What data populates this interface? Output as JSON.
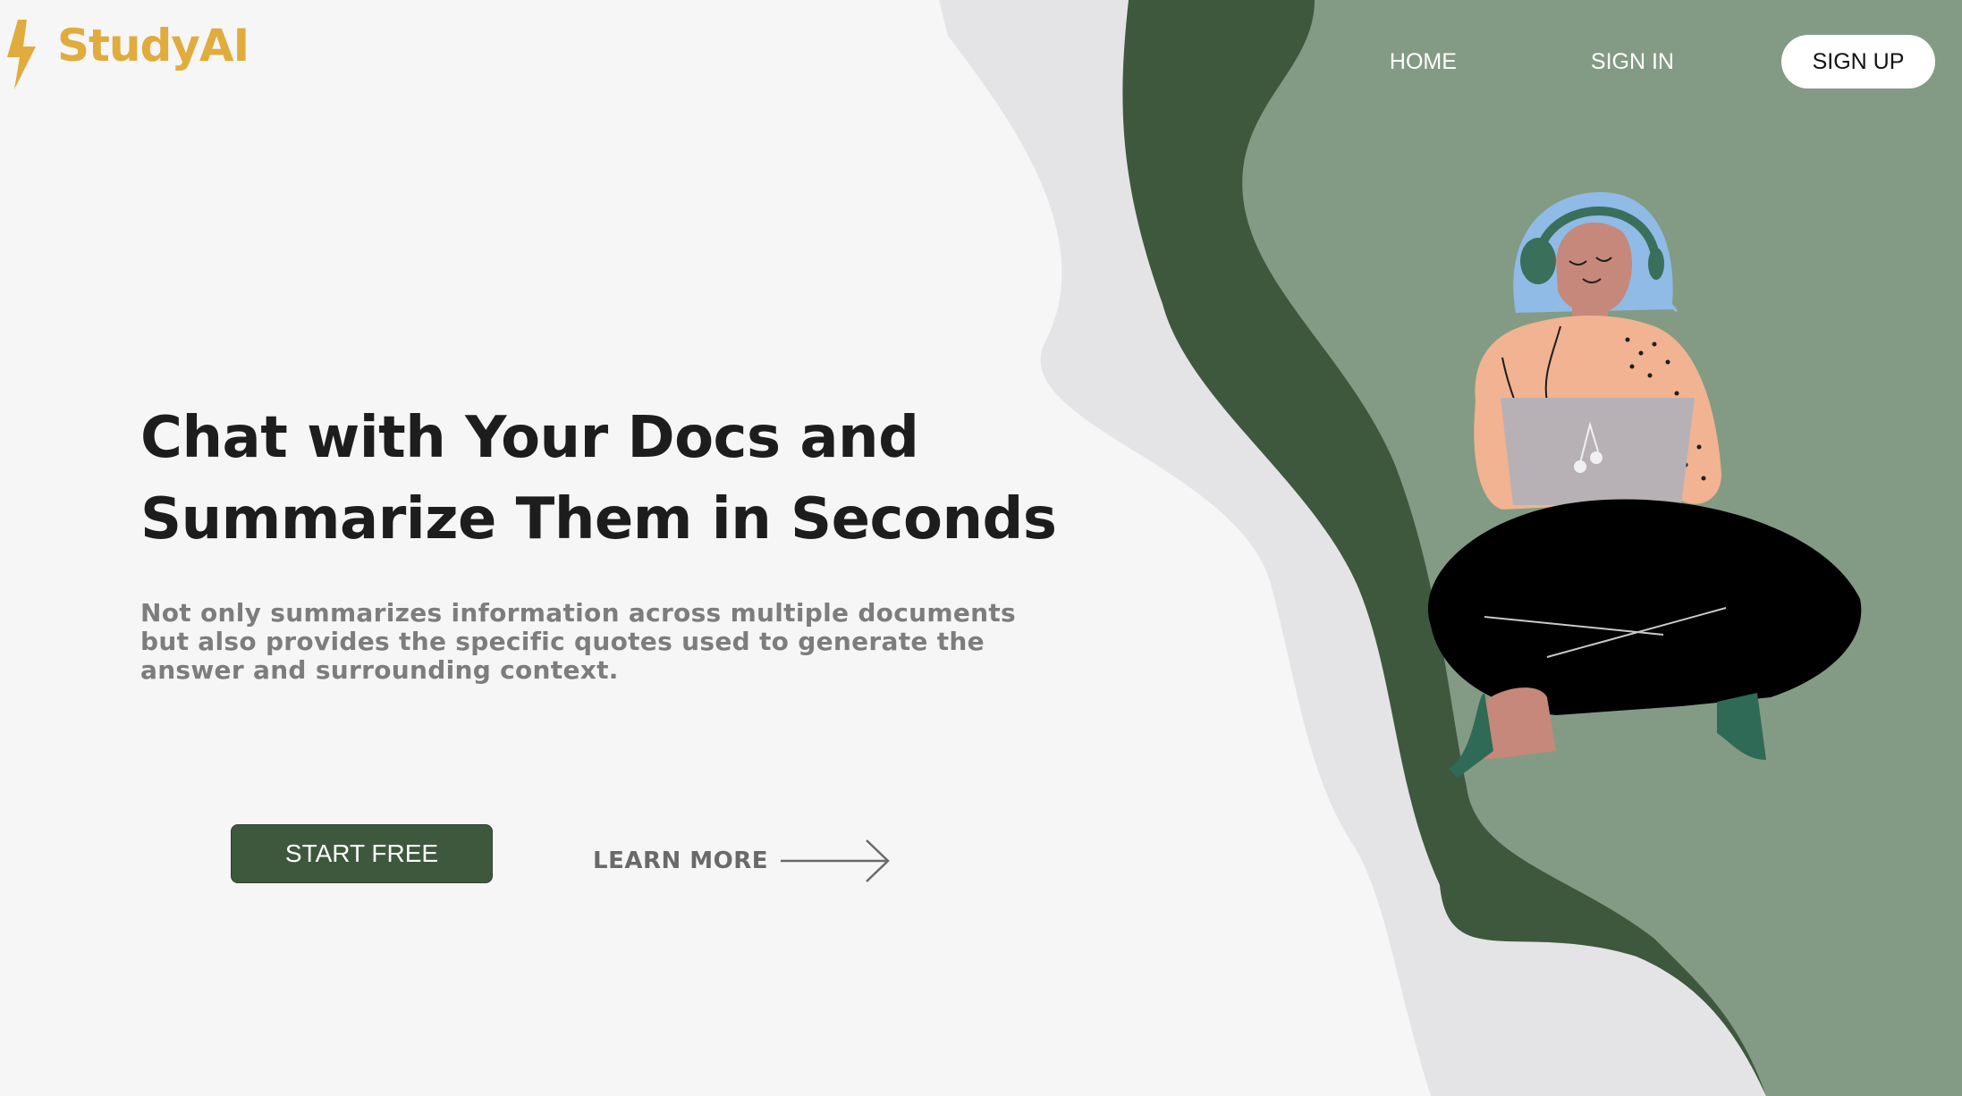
{
  "brand": {
    "name": "StudyAI",
    "logo_icon": "lightning-bolt-icon",
    "color": "#e0ac3e"
  },
  "nav": {
    "home": "HOME",
    "sign_in": "SIGN IN",
    "sign_up": "SIGN UP"
  },
  "hero": {
    "title_line1": "Chat with Your Docs and",
    "title_line2": "Summarize Them in Seconds",
    "description": "Not only summarizes information across multiple documents but also provides the specific quotes used to generate the answer and surrounding context.",
    "start_button": "START FREE",
    "learn_more": "LEARN MORE",
    "learn_more_icon": "arrow-right-icon"
  },
  "colors": {
    "background": "#f6f6f6",
    "dark_green": "#3e583d",
    "sage_green": "#839b84",
    "light_grey": "#e4e4e6",
    "accent_gold": "#e0ac3e"
  },
  "illustration": {
    "subject": "woman-with-headphones-and-laptop-illustration"
  }
}
